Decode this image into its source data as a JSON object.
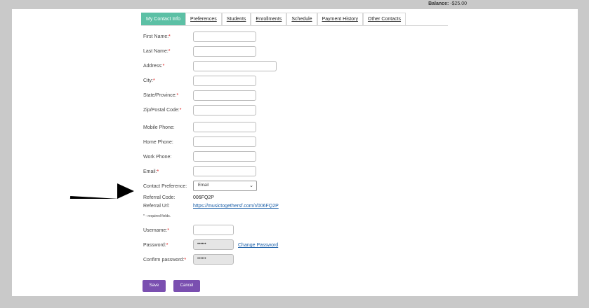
{
  "header": {
    "balance_label": "Balance:",
    "balance_value": "-$25.00"
  },
  "tabs": [
    {
      "label": "My Contact Info",
      "active": true
    },
    {
      "label": "Preferences"
    },
    {
      "label": "Students"
    },
    {
      "label": "Enrollments"
    },
    {
      "label": "Schedule"
    },
    {
      "label": "Payment History"
    },
    {
      "label": "Other Contacts"
    }
  ],
  "form": {
    "first_name": {
      "label": "First Name:",
      "required": "*",
      "value": ""
    },
    "last_name": {
      "label": "Last Name:",
      "required": "*",
      "value": ""
    },
    "address": {
      "label": "Address:",
      "required": "*",
      "value": ""
    },
    "city": {
      "label": "City:",
      "required": "*",
      "value": ""
    },
    "state": {
      "label": "State/Province:",
      "required": "*",
      "value": ""
    },
    "zip": {
      "label": "Zip/Postal Code:",
      "required": "*",
      "value": ""
    },
    "mobile_phone": {
      "label": "Mobile Phone:",
      "value": ""
    },
    "home_phone": {
      "label": "Home Phone:",
      "value": ""
    },
    "work_phone": {
      "label": "Work Phone:",
      "value": ""
    },
    "email": {
      "label": "Email:",
      "required": "*",
      "value": ""
    },
    "contact_preference": {
      "label": "Contact Preference:",
      "selected": "Email"
    },
    "referral_code": {
      "label": "Referral Code:",
      "value": "006FQ2P"
    },
    "referral_url": {
      "label": "Referral Url:",
      "value": "https://musictogethersf.com/r/006FQ2P"
    },
    "required_note": "* - required fields.",
    "username": {
      "label": "Username:",
      "required": "*",
      "value": ""
    },
    "password": {
      "label": "Password:",
      "required": "*",
      "value": "••••••",
      "change_link": "Change Password"
    },
    "confirm_password": {
      "label": "Confirm password:",
      "required": "*",
      "value": "••••••"
    }
  },
  "actions": {
    "save": "Save",
    "cancel": "Cancel"
  },
  "colors": {
    "active_tab": "#5cc0a5",
    "button": "#7a4fb0",
    "link": "#1b5fa8",
    "required": "#dd1111"
  }
}
